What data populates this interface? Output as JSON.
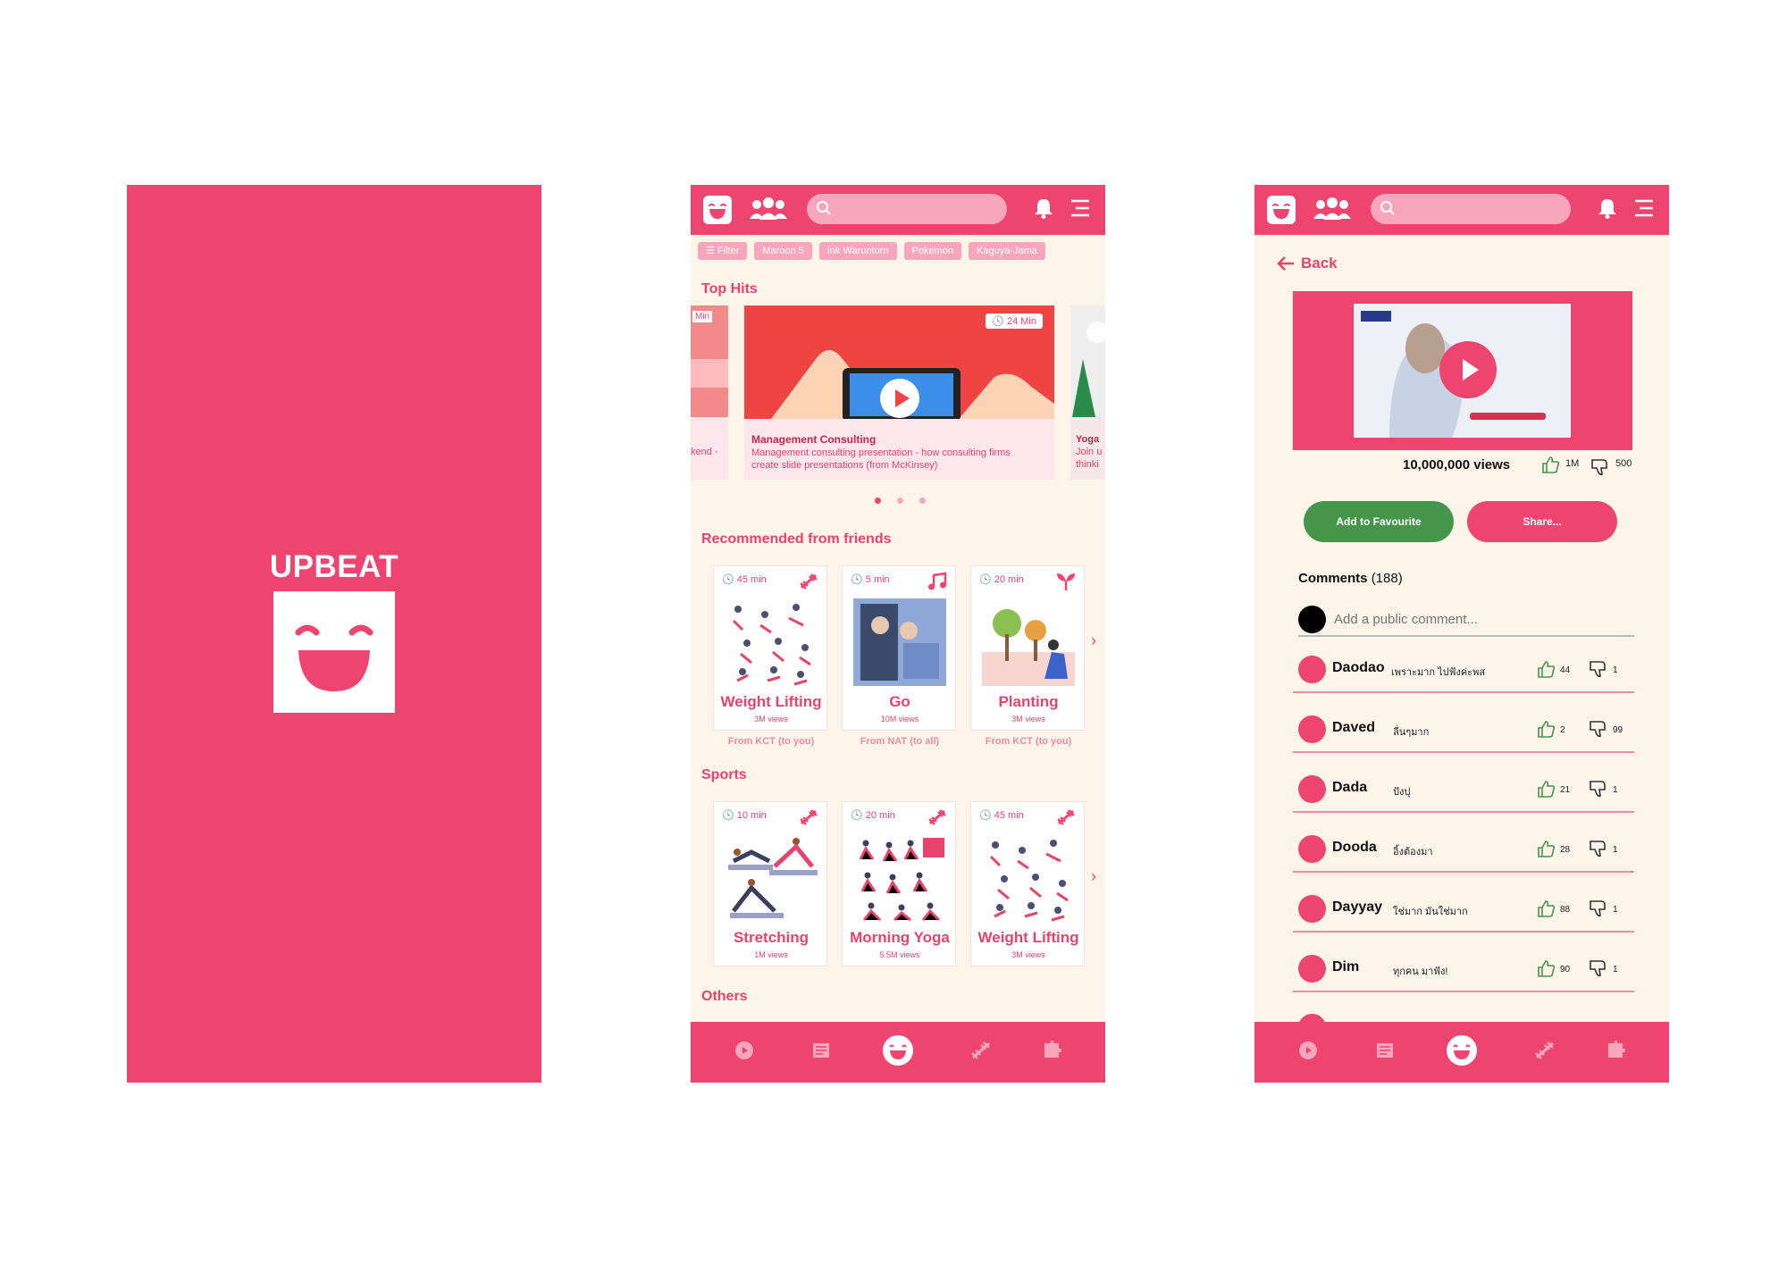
{
  "splash": {
    "title": "UPBEAT"
  },
  "header": {
    "search_placeholder": ""
  },
  "home": {
    "chips": [
      "☰ Filter",
      "Maroon 5",
      "Ink Waruntorn",
      "Pokemon",
      "Kaguya-Jama"
    ],
    "top_hits_title": "Top Hits",
    "hero": {
      "time": "24 Min",
      "title": "Management Consulting",
      "description": "Management consulting presentation - how consulting firms create slide presentations (from McKinsey)"
    },
    "side_left": {
      "time": "Min",
      "text": "kend -"
    },
    "side_right": {
      "title": "Yoga",
      "line1": "Join u",
      "line2": "thinki"
    },
    "recommended_title": "Recommended from friends",
    "recommended": [
      {
        "time": "45 min",
        "title": "Weight Lifting",
        "views": "3M views",
        "from": "From KCT (to you)"
      },
      {
        "time": "5 min",
        "title": "Go",
        "views": "10M views",
        "from": "From NAT (to all)"
      },
      {
        "time": "20 min",
        "title": "Planting",
        "views": "3M views",
        "from": "From KCT (to you)"
      }
    ],
    "sports_title": "Sports",
    "sports": [
      {
        "time": "10 min",
        "title": "Stretching",
        "views": "1M views"
      },
      {
        "time": "20 min",
        "title": "Morning Yoga",
        "views": "5.5M views"
      },
      {
        "time": "45 min",
        "title": "Weight Lifting",
        "views": "3M views"
      }
    ],
    "others_title": "Others"
  },
  "detail": {
    "back_label": "Back",
    "views": "10,000,000 views",
    "likes": "1M",
    "dislikes": "500",
    "fav_label": "Add to Favourite",
    "share_label": "Share...",
    "comments_label": "Comments",
    "comments_count": "(188)",
    "comment_placeholder": "Add a public comment...",
    "comments": [
      {
        "name": "Daodao",
        "text": "เพราะมาก ไปฟังค่ะพส",
        "likes": "44",
        "dislikes": "1"
      },
      {
        "name": "Daved",
        "text": "ลื่นๆมาก",
        "likes": "2",
        "dislikes": "99"
      },
      {
        "name": "Dada",
        "text": "ปังปุ",
        "likes": "21",
        "dislikes": "1"
      },
      {
        "name": "Dooda",
        "text": "อิ้งต้องมา",
        "likes": "28",
        "dislikes": "1"
      },
      {
        "name": "Dayyay",
        "text": "ใช่มาก มันใช่มาก",
        "likes": "88",
        "dislikes": "1"
      },
      {
        "name": "Dim",
        "text": "ทุกคน มาฟัง!",
        "likes": "90",
        "dislikes": "1"
      }
    ]
  },
  "colors": {
    "brand": "#ee4470",
    "background": "#fdf4ea",
    "favourite": "#45964a"
  }
}
